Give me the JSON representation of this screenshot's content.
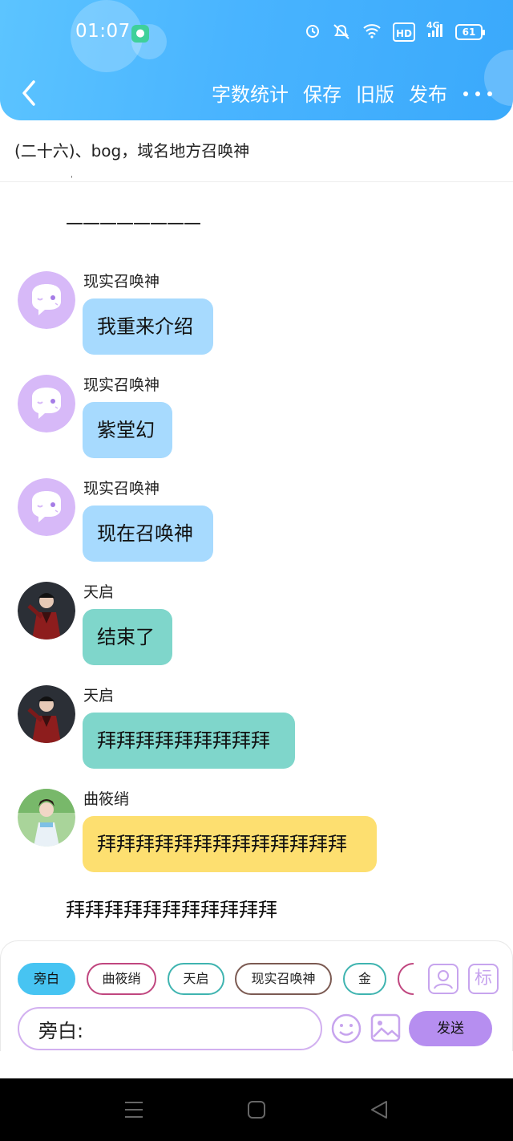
{
  "status_bar": {
    "time": "01:07",
    "network": "4G",
    "hd": "HD",
    "battery": "61"
  },
  "toolbar": {
    "word_count": "字数统计",
    "save": "保存",
    "old_version": "旧版",
    "publish": "发布"
  },
  "chapter": {
    "title": "(二十六)、bog，域名地方召唤神",
    "mark": "'"
  },
  "dash_line": "————————",
  "messages": [
    {
      "sender": "现实召唤神",
      "text": "我重来介绍",
      "bubble_color": "#a7dafe",
      "avatar": "ghost-avatar"
    },
    {
      "sender": "现实召唤神",
      "text": "紫堂幻",
      "bubble_color": "#a7dafe",
      "avatar": "ghost-avatar"
    },
    {
      "sender": "现实召唤神",
      "text": "现在召唤神",
      "bubble_color": "#a7dafe",
      "avatar": "ghost-avatar"
    },
    {
      "sender": "天启",
      "text": "结束了",
      "bubble_color": "#7fd6cb",
      "avatar": "warrior-avatar"
    },
    {
      "sender": "天启",
      "text": "拜拜拜拜拜拜拜拜拜",
      "bubble_color": "#7fd6cb",
      "avatar": "warrior-avatar"
    },
    {
      "sender": "曲筱绡",
      "text": "拜拜拜拜拜拜拜拜拜拜拜拜拜",
      "bubble_color": "#fddf70",
      "avatar": "woman-avatar"
    }
  ],
  "narration": "拜拜拜拜拜拜拜拜拜拜拜",
  "roles": {
    "narrator": "旁白",
    "r1": "曲筱绡",
    "r2": "天启",
    "r3": "现实召唤神",
    "r4": "金"
  },
  "side_buttons": {
    "character": "person-icon",
    "tag": "标"
  },
  "input": {
    "value": "旁白:"
  },
  "send": "发送",
  "colors": {
    "header": "#49b4ff",
    "accent_purple": "#b68ef0",
    "bubble_blue": "#a7dafe",
    "bubble_teal": "#7fd6cb",
    "bubble_yellow": "#fddf70"
  }
}
